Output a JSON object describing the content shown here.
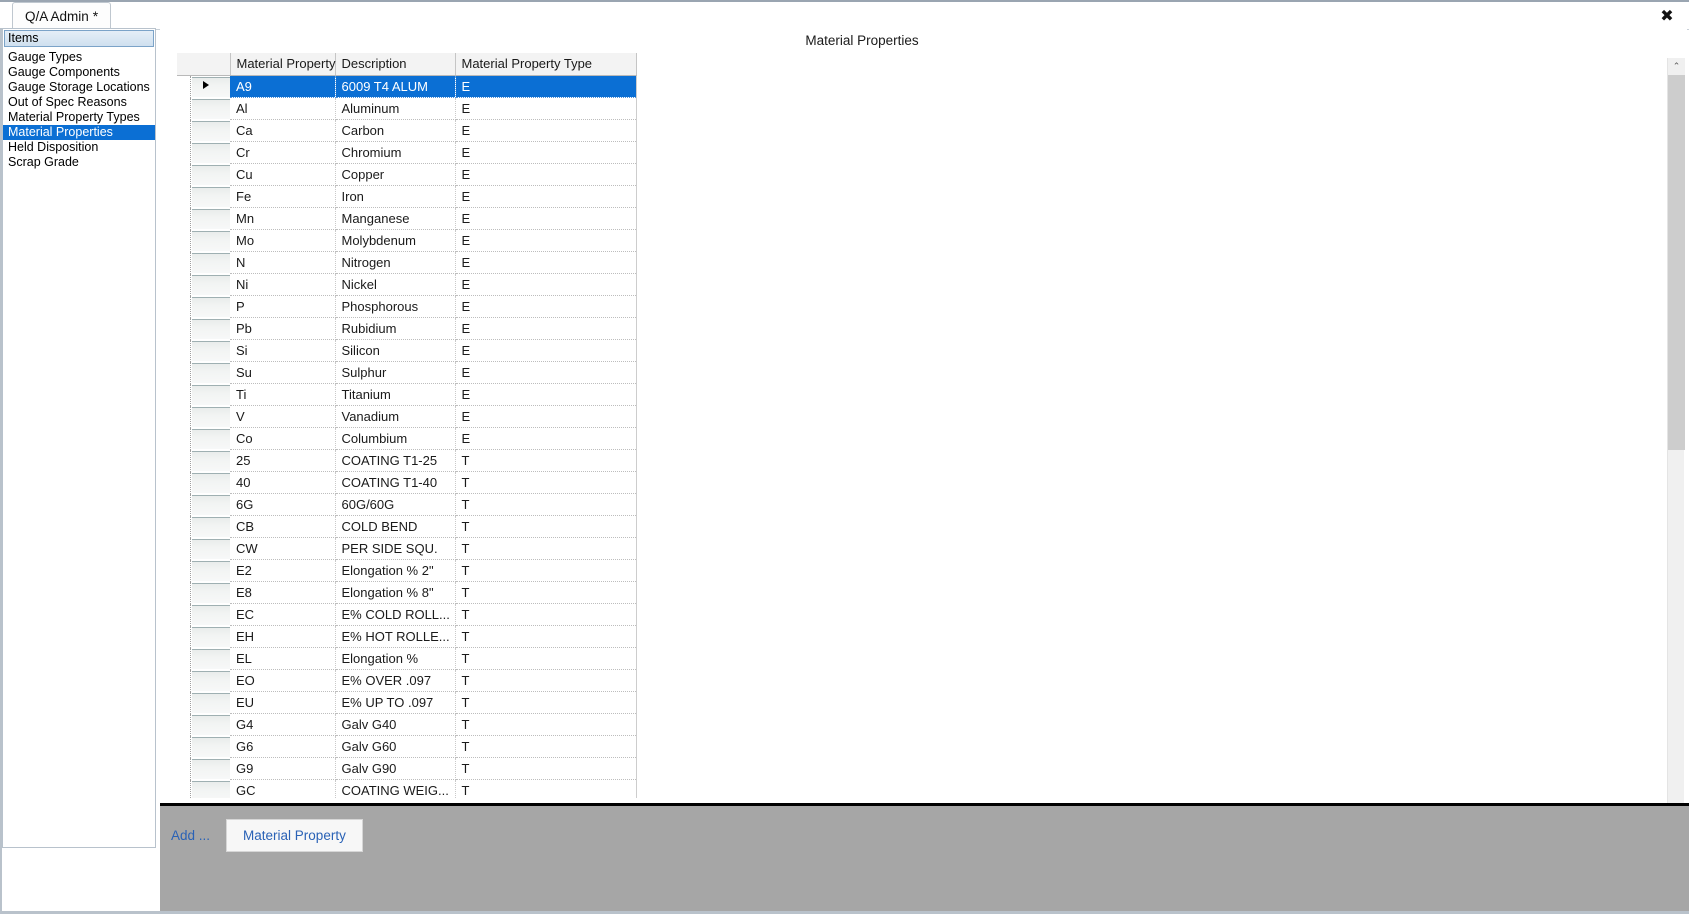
{
  "window": {
    "close_label": "✖"
  },
  "tabs": [
    {
      "label": "Q/A Admin",
      "dirty_marker": "*",
      "active": true
    }
  ],
  "sidebar": {
    "header": "Items",
    "items": [
      {
        "label": "Gauge Types",
        "selected": false
      },
      {
        "label": "Gauge Components",
        "selected": false
      },
      {
        "label": "Gauge Storage Locations",
        "selected": false
      },
      {
        "label": "Out of Spec Reasons",
        "selected": false
      },
      {
        "label": "Material Property Types",
        "selected": false
      },
      {
        "label": "Material Properties",
        "selected": true
      },
      {
        "label": "Held Disposition",
        "selected": false
      },
      {
        "label": "Scrap Grade",
        "selected": false
      }
    ]
  },
  "main": {
    "title": "Material Properties"
  },
  "grid": {
    "columns": [
      "",
      "Material Property",
      "Description",
      "Material Property Type"
    ],
    "selected_row_index": 0,
    "rows": [
      {
        "property": "A9",
        "description": "6009 T4 ALUM",
        "type": "E"
      },
      {
        "property": "Al",
        "description": "Aluminum",
        "type": "E"
      },
      {
        "property": "Ca",
        "description": "Carbon",
        "type": "E"
      },
      {
        "property": "Cr",
        "description": "Chromium",
        "type": "E"
      },
      {
        "property": "Cu",
        "description": "Copper",
        "type": "E"
      },
      {
        "property": "Fe",
        "description": "Iron",
        "type": "E"
      },
      {
        "property": "Mn",
        "description": "Manganese",
        "type": "E"
      },
      {
        "property": "Mo",
        "description": "Molybdenum",
        "type": "E"
      },
      {
        "property": "N",
        "description": "Nitrogen",
        "type": "E"
      },
      {
        "property": "Ni",
        "description": "Nickel",
        "type": "E"
      },
      {
        "property": "P",
        "description": "Phosphorous",
        "type": "E"
      },
      {
        "property": "Pb",
        "description": "Rubidium",
        "type": "E"
      },
      {
        "property": "Si",
        "description": "Silicon",
        "type": "E"
      },
      {
        "property": "Su",
        "description": "Sulphur",
        "type": "E"
      },
      {
        "property": "Ti",
        "description": "Titanium",
        "type": "E"
      },
      {
        "property": "V",
        "description": "Vanadium",
        "type": "E"
      },
      {
        "property": "Co",
        "description": "Columbium",
        "type": "E"
      },
      {
        "property": "25",
        "description": "COATING T1-25",
        "type": "T"
      },
      {
        "property": "40",
        "description": "COATING T1-40",
        "type": "T"
      },
      {
        "property": "6G",
        "description": "60G/60G",
        "type": "T"
      },
      {
        "property": "CB",
        "description": "COLD BEND",
        "type": "T"
      },
      {
        "property": "CW",
        "description": "PER SIDE SQU.",
        "type": "T"
      },
      {
        "property": "E2",
        "description": "Elongation % 2\"",
        "type": "T"
      },
      {
        "property": "E8",
        "description": "Elongation % 8\"",
        "type": "T"
      },
      {
        "property": "EC",
        "description": "E% COLD ROLL...",
        "type": "T"
      },
      {
        "property": "EH",
        "description": "E% HOT ROLLE...",
        "type": "T"
      },
      {
        "property": "EL",
        "description": "Elongation %",
        "type": "T"
      },
      {
        "property": "EO",
        "description": "E% OVER .097",
        "type": "T"
      },
      {
        "property": "EU",
        "description": "E% UP TO .097",
        "type": "T"
      },
      {
        "property": "G4",
        "description": "Galv G40",
        "type": "T"
      },
      {
        "property": "G6",
        "description": "Galv G60",
        "type": "T"
      },
      {
        "property": "G9",
        "description": "Galv G90",
        "type": "T"
      },
      {
        "property": "GC",
        "description": "COATING WEIG...",
        "type": "T"
      }
    ]
  },
  "scrollbar": {
    "up_arrow": "⌃",
    "down_arrow": "⌄"
  },
  "bottombar": {
    "add_label": "Add ...",
    "add_material_property_label": "Material Property"
  },
  "colors": {
    "selection_blue": "#0b6fd4",
    "link_blue": "#2a62b6",
    "bottombar_gray": "#a6a6a6"
  }
}
